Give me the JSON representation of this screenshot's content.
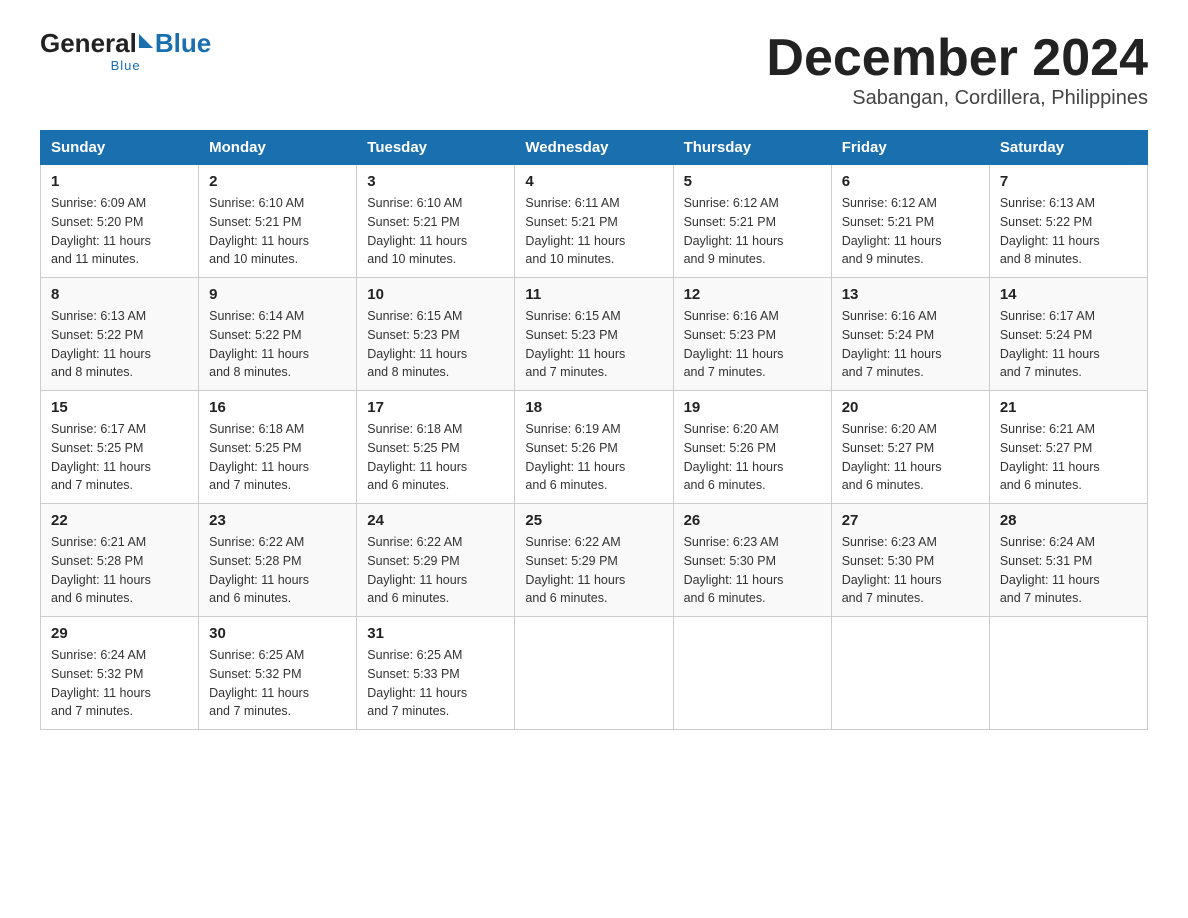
{
  "logo": {
    "general": "General",
    "blue": "Blue",
    "tagline": "Blue"
  },
  "header": {
    "month": "December 2024",
    "location": "Sabangan, Cordillera, Philippines"
  },
  "days_of_week": [
    "Sunday",
    "Monday",
    "Tuesday",
    "Wednesday",
    "Thursday",
    "Friday",
    "Saturday"
  ],
  "weeks": [
    [
      {
        "day": "1",
        "sunrise": "6:09 AM",
        "sunset": "5:20 PM",
        "daylight": "11 hours and 11 minutes."
      },
      {
        "day": "2",
        "sunrise": "6:10 AM",
        "sunset": "5:21 PM",
        "daylight": "11 hours and 10 minutes."
      },
      {
        "day": "3",
        "sunrise": "6:10 AM",
        "sunset": "5:21 PM",
        "daylight": "11 hours and 10 minutes."
      },
      {
        "day": "4",
        "sunrise": "6:11 AM",
        "sunset": "5:21 PM",
        "daylight": "11 hours and 10 minutes."
      },
      {
        "day": "5",
        "sunrise": "6:12 AM",
        "sunset": "5:21 PM",
        "daylight": "11 hours and 9 minutes."
      },
      {
        "day": "6",
        "sunrise": "6:12 AM",
        "sunset": "5:21 PM",
        "daylight": "11 hours and 9 minutes."
      },
      {
        "day": "7",
        "sunrise": "6:13 AM",
        "sunset": "5:22 PM",
        "daylight": "11 hours and 8 minutes."
      }
    ],
    [
      {
        "day": "8",
        "sunrise": "6:13 AM",
        "sunset": "5:22 PM",
        "daylight": "11 hours and 8 minutes."
      },
      {
        "day": "9",
        "sunrise": "6:14 AM",
        "sunset": "5:22 PM",
        "daylight": "11 hours and 8 minutes."
      },
      {
        "day": "10",
        "sunrise": "6:15 AM",
        "sunset": "5:23 PM",
        "daylight": "11 hours and 8 minutes."
      },
      {
        "day": "11",
        "sunrise": "6:15 AM",
        "sunset": "5:23 PM",
        "daylight": "11 hours and 7 minutes."
      },
      {
        "day": "12",
        "sunrise": "6:16 AM",
        "sunset": "5:23 PM",
        "daylight": "11 hours and 7 minutes."
      },
      {
        "day": "13",
        "sunrise": "6:16 AM",
        "sunset": "5:24 PM",
        "daylight": "11 hours and 7 minutes."
      },
      {
        "day": "14",
        "sunrise": "6:17 AM",
        "sunset": "5:24 PM",
        "daylight": "11 hours and 7 minutes."
      }
    ],
    [
      {
        "day": "15",
        "sunrise": "6:17 AM",
        "sunset": "5:25 PM",
        "daylight": "11 hours and 7 minutes."
      },
      {
        "day": "16",
        "sunrise": "6:18 AM",
        "sunset": "5:25 PM",
        "daylight": "11 hours and 7 minutes."
      },
      {
        "day": "17",
        "sunrise": "6:18 AM",
        "sunset": "5:25 PM",
        "daylight": "11 hours and 6 minutes."
      },
      {
        "day": "18",
        "sunrise": "6:19 AM",
        "sunset": "5:26 PM",
        "daylight": "11 hours and 6 minutes."
      },
      {
        "day": "19",
        "sunrise": "6:20 AM",
        "sunset": "5:26 PM",
        "daylight": "11 hours and 6 minutes."
      },
      {
        "day": "20",
        "sunrise": "6:20 AM",
        "sunset": "5:27 PM",
        "daylight": "11 hours and 6 minutes."
      },
      {
        "day": "21",
        "sunrise": "6:21 AM",
        "sunset": "5:27 PM",
        "daylight": "11 hours and 6 minutes."
      }
    ],
    [
      {
        "day": "22",
        "sunrise": "6:21 AM",
        "sunset": "5:28 PM",
        "daylight": "11 hours and 6 minutes."
      },
      {
        "day": "23",
        "sunrise": "6:22 AM",
        "sunset": "5:28 PM",
        "daylight": "11 hours and 6 minutes."
      },
      {
        "day": "24",
        "sunrise": "6:22 AM",
        "sunset": "5:29 PM",
        "daylight": "11 hours and 6 minutes."
      },
      {
        "day": "25",
        "sunrise": "6:22 AM",
        "sunset": "5:29 PM",
        "daylight": "11 hours and 6 minutes."
      },
      {
        "day": "26",
        "sunrise": "6:23 AM",
        "sunset": "5:30 PM",
        "daylight": "11 hours and 6 minutes."
      },
      {
        "day": "27",
        "sunrise": "6:23 AM",
        "sunset": "5:30 PM",
        "daylight": "11 hours and 7 minutes."
      },
      {
        "day": "28",
        "sunrise": "6:24 AM",
        "sunset": "5:31 PM",
        "daylight": "11 hours and 7 minutes."
      }
    ],
    [
      {
        "day": "29",
        "sunrise": "6:24 AM",
        "sunset": "5:32 PM",
        "daylight": "11 hours and 7 minutes."
      },
      {
        "day": "30",
        "sunrise": "6:25 AM",
        "sunset": "5:32 PM",
        "daylight": "11 hours and 7 minutes."
      },
      {
        "day": "31",
        "sunrise": "6:25 AM",
        "sunset": "5:33 PM",
        "daylight": "11 hours and 7 minutes."
      },
      null,
      null,
      null,
      null
    ]
  ]
}
